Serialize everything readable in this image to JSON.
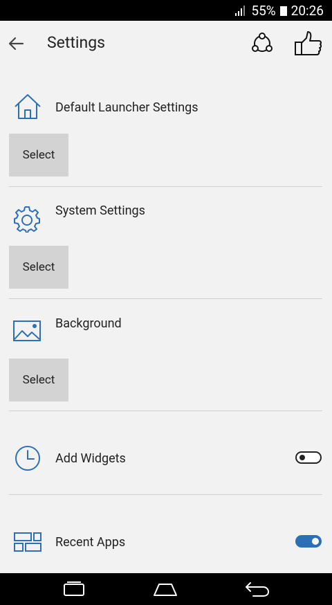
{
  "status_bar": {
    "battery": "55%",
    "time": "20:26"
  },
  "app_bar": {
    "title": "Settings"
  },
  "sections": [
    {
      "label": "Default Launcher Settings",
      "button": "Select",
      "icon": "home-icon"
    },
    {
      "label": "System Settings",
      "button": "Select",
      "icon": "gear-icon"
    },
    {
      "label": "Background",
      "button": "Select",
      "icon": "image-icon"
    }
  ],
  "toggles": [
    {
      "label": "Add Widgets",
      "on": false,
      "icon": "clock-icon"
    },
    {
      "label": "Recent Apps",
      "on": true,
      "icon": "recent-apps-icon"
    }
  ],
  "colors": {
    "accent": "#2d6fb4",
    "button_bg": "#d3d3d3",
    "background": "#f2f2f2"
  }
}
